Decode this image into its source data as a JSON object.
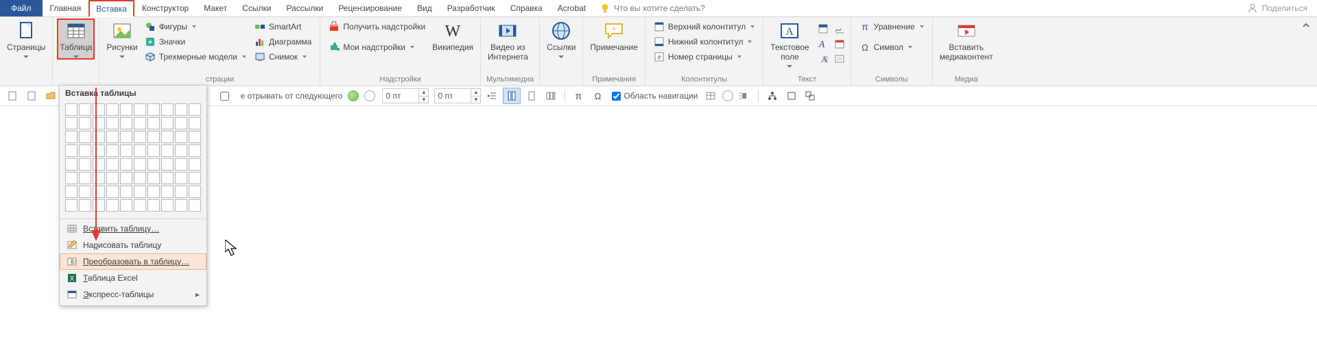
{
  "tabs": {
    "file": "Файл",
    "items": [
      "Главная",
      "Вставка",
      "Конструктор",
      "Макет",
      "Ссылки",
      "Рассылки",
      "Рецензирование",
      "Вид",
      "Разработчик",
      "Справка",
      "Acrobat"
    ],
    "active_index": 1,
    "tell_me_placeholder": "Что вы хотите сделать?",
    "share": "Поделиться"
  },
  "ribbon": {
    "pages": {
      "btn": "Страницы",
      "group": "",
      "icon": "pages"
    },
    "table": {
      "btn": "Таблица",
      "group": "",
      "icon": "table"
    },
    "illustrations": {
      "group": "Иллюстрации",
      "pictures": "Рисунки",
      "shapes": "Фигуры",
      "icons": "Значки",
      "models_3d": "Трехмерные модели",
      "smartart": "SmartArt",
      "chart": "Диаграмма",
      "screenshot": "Снимок"
    },
    "addins": {
      "group": "Надстройки",
      "get": "Получить надстройки",
      "my": "Мои надстройки",
      "wiki": "Википедия"
    },
    "media": {
      "group": "Мультимедиа",
      "video": "Видео из\nИнтернета"
    },
    "links": {
      "group": "",
      "btn": "Ссылки"
    },
    "comments": {
      "group": "Примечания",
      "btn": "Примечание"
    },
    "headerfooter": {
      "group": "Колонтитулы",
      "header": "Верхний колонтитул",
      "footer": "Нижний колонтитул",
      "pagenum": "Номер страницы"
    },
    "text": {
      "group": "Текст",
      "textbox": "Текстовое\nполе"
    },
    "symbols": {
      "group": "Символы",
      "equation": "Уравнение",
      "symbol": "Символ"
    },
    "embed": {
      "group": "Медиа",
      "btn": "Вставить\nмедиаконтент"
    }
  },
  "qat": {
    "keep_with_next": "Не отрывать от следующего",
    "spin1": "0 пт",
    "spin2": "0 пт",
    "nav_pane": "Область навигации"
  },
  "table_menu": {
    "title": "Вставка таблицы",
    "grid_cols": 10,
    "grid_rows": 8,
    "items": [
      {
        "icon": "insert-table",
        "label": "Вставить таблицу…",
        "ul": 0
      },
      {
        "icon": "draw-table",
        "label": "Нарисовать таблицу",
        "ul": 2
      },
      {
        "icon": "convert",
        "label": "Преобразовать в таблицу…",
        "ul": 0,
        "hover": true
      },
      {
        "icon": "excel",
        "label": "Таблица Excel",
        "ul": 0
      },
      {
        "icon": "quick",
        "label": "Экспресс-таблицы",
        "ul": 0,
        "submenu": true
      }
    ]
  },
  "colors": {
    "accent": "#2b579a",
    "highlight": "#e33b2e"
  }
}
